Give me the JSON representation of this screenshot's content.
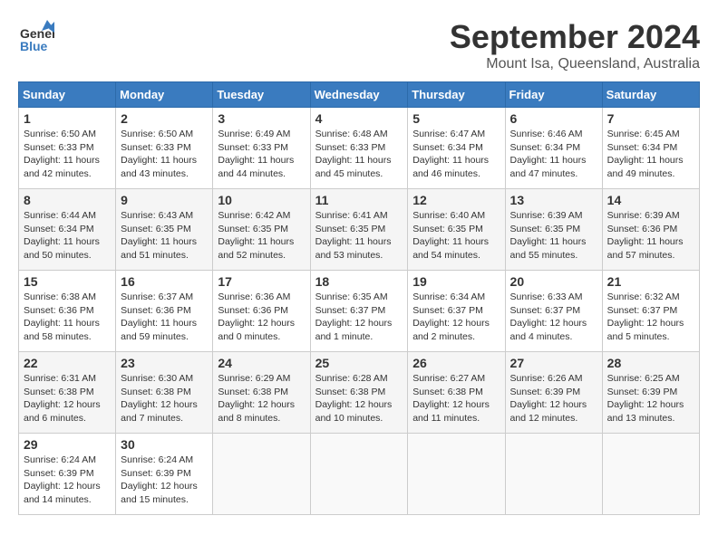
{
  "header": {
    "logo_line1": "General",
    "logo_line2": "Blue",
    "title": "September 2024",
    "subtitle": "Mount Isa, Queensland, Australia"
  },
  "weekdays": [
    "Sunday",
    "Monday",
    "Tuesday",
    "Wednesday",
    "Thursday",
    "Friday",
    "Saturday"
  ],
  "weeks": [
    [
      {
        "day": "1",
        "sunrise": "6:50 AM",
        "sunset": "6:33 PM",
        "daylight": "11 hours and 42 minutes."
      },
      {
        "day": "2",
        "sunrise": "6:50 AM",
        "sunset": "6:33 PM",
        "daylight": "11 hours and 43 minutes."
      },
      {
        "day": "3",
        "sunrise": "6:49 AM",
        "sunset": "6:33 PM",
        "daylight": "11 hours and 44 minutes."
      },
      {
        "day": "4",
        "sunrise": "6:48 AM",
        "sunset": "6:33 PM",
        "daylight": "11 hours and 45 minutes."
      },
      {
        "day": "5",
        "sunrise": "6:47 AM",
        "sunset": "6:34 PM",
        "daylight": "11 hours and 46 minutes."
      },
      {
        "day": "6",
        "sunrise": "6:46 AM",
        "sunset": "6:34 PM",
        "daylight": "11 hours and 47 minutes."
      },
      {
        "day": "7",
        "sunrise": "6:45 AM",
        "sunset": "6:34 PM",
        "daylight": "11 hours and 49 minutes."
      }
    ],
    [
      {
        "day": "8",
        "sunrise": "6:44 AM",
        "sunset": "6:34 PM",
        "daylight": "11 hours and 50 minutes."
      },
      {
        "day": "9",
        "sunrise": "6:43 AM",
        "sunset": "6:35 PM",
        "daylight": "11 hours and 51 minutes."
      },
      {
        "day": "10",
        "sunrise": "6:42 AM",
        "sunset": "6:35 PM",
        "daylight": "11 hours and 52 minutes."
      },
      {
        "day": "11",
        "sunrise": "6:41 AM",
        "sunset": "6:35 PM",
        "daylight": "11 hours and 53 minutes."
      },
      {
        "day": "12",
        "sunrise": "6:40 AM",
        "sunset": "6:35 PM",
        "daylight": "11 hours and 54 minutes."
      },
      {
        "day": "13",
        "sunrise": "6:39 AM",
        "sunset": "6:35 PM",
        "daylight": "11 hours and 55 minutes."
      },
      {
        "day": "14",
        "sunrise": "6:39 AM",
        "sunset": "6:36 PM",
        "daylight": "11 hours and 57 minutes."
      }
    ],
    [
      {
        "day": "15",
        "sunrise": "6:38 AM",
        "sunset": "6:36 PM",
        "daylight": "11 hours and 58 minutes."
      },
      {
        "day": "16",
        "sunrise": "6:37 AM",
        "sunset": "6:36 PM",
        "daylight": "11 hours and 59 minutes."
      },
      {
        "day": "17",
        "sunrise": "6:36 AM",
        "sunset": "6:36 PM",
        "daylight": "12 hours and 0 minutes."
      },
      {
        "day": "18",
        "sunrise": "6:35 AM",
        "sunset": "6:37 PM",
        "daylight": "12 hours and 1 minute."
      },
      {
        "day": "19",
        "sunrise": "6:34 AM",
        "sunset": "6:37 PM",
        "daylight": "12 hours and 2 minutes."
      },
      {
        "day": "20",
        "sunrise": "6:33 AM",
        "sunset": "6:37 PM",
        "daylight": "12 hours and 4 minutes."
      },
      {
        "day": "21",
        "sunrise": "6:32 AM",
        "sunset": "6:37 PM",
        "daylight": "12 hours and 5 minutes."
      }
    ],
    [
      {
        "day": "22",
        "sunrise": "6:31 AM",
        "sunset": "6:38 PM",
        "daylight": "12 hours and 6 minutes."
      },
      {
        "day": "23",
        "sunrise": "6:30 AM",
        "sunset": "6:38 PM",
        "daylight": "12 hours and 7 minutes."
      },
      {
        "day": "24",
        "sunrise": "6:29 AM",
        "sunset": "6:38 PM",
        "daylight": "12 hours and 8 minutes."
      },
      {
        "day": "25",
        "sunrise": "6:28 AM",
        "sunset": "6:38 PM",
        "daylight": "12 hours and 10 minutes."
      },
      {
        "day": "26",
        "sunrise": "6:27 AM",
        "sunset": "6:38 PM",
        "daylight": "12 hours and 11 minutes."
      },
      {
        "day": "27",
        "sunrise": "6:26 AM",
        "sunset": "6:39 PM",
        "daylight": "12 hours and 12 minutes."
      },
      {
        "day": "28",
        "sunrise": "6:25 AM",
        "sunset": "6:39 PM",
        "daylight": "12 hours and 13 minutes."
      }
    ],
    [
      {
        "day": "29",
        "sunrise": "6:24 AM",
        "sunset": "6:39 PM",
        "daylight": "12 hours and 14 minutes."
      },
      {
        "day": "30",
        "sunrise": "6:24 AM",
        "sunset": "6:39 PM",
        "daylight": "12 hours and 15 minutes."
      },
      null,
      null,
      null,
      null,
      null
    ]
  ]
}
